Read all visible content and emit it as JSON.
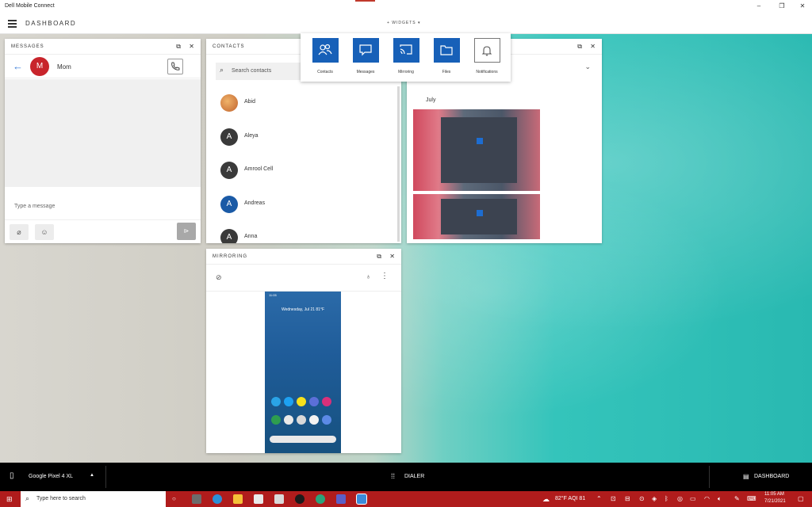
{
  "window": {
    "title": "Dell Mobile Connect",
    "minimize": "–",
    "maximize": "❐",
    "close": "✕"
  },
  "header": {
    "title": "DASHBOARD",
    "widgets_label": "+ WIDGETS ▾"
  },
  "messages_panel": {
    "title": "MESSAGES",
    "contact_initial": "M",
    "contact_name": "Mom",
    "input_placeholder": "Type a message",
    "avatar_color": "#c8242b"
  },
  "contacts_panel": {
    "title": "CONTACTS",
    "search_placeholder": "Search contacts",
    "contacts": [
      {
        "initial": "",
        "name": "Abid",
        "color": "#e08a3c"
      },
      {
        "initial": "A",
        "name": "Aleya",
        "color": "#3a3a3a"
      },
      {
        "initial": "A",
        "name": "Amrool Cell",
        "color": "#3a3a3a"
      },
      {
        "initial": "A",
        "name": "Andreas",
        "color": "#1a5aa6"
      },
      {
        "initial": "A",
        "name": "Anna",
        "color": "#3a3a3a"
      }
    ]
  },
  "widgets": [
    {
      "label": "Contacts",
      "icon": "contacts-icon"
    },
    {
      "label": "Messages",
      "icon": "message-icon"
    },
    {
      "label": "Mirroring",
      "icon": "cast-icon"
    },
    {
      "label": "Files",
      "icon": "folder-icon"
    },
    {
      "label": "Notifications",
      "icon": "bell-icon"
    }
  ],
  "files_panel": {
    "month": "July"
  },
  "mirroring_panel": {
    "title": "MIRRORING",
    "phone_date": "Wednesday, Jul 21 81°F",
    "phone_time": "11:05"
  },
  "dell_bar": {
    "device": "Google Pixel 4 XL",
    "dialer": "DIALER",
    "dashboard": "DASHBOARD"
  },
  "taskbar": {
    "search_placeholder": "Type here to search",
    "weather": "82°F AQI 81",
    "time": "11:05 AM",
    "date": "7/21/2021",
    "color": "#b01c1c"
  }
}
